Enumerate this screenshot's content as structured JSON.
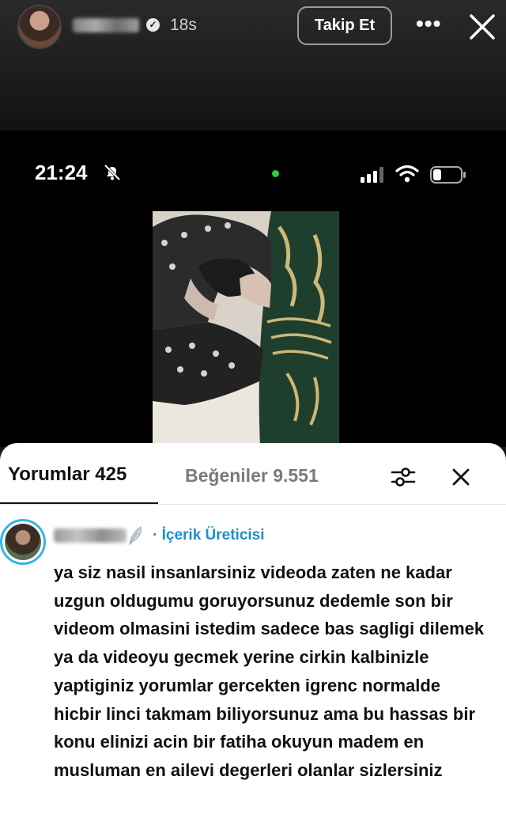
{
  "story": {
    "time_ago": "18s",
    "follow_label": "Takip Et",
    "more_label": "•••"
  },
  "phone_status": {
    "time": "21:24"
  },
  "sheet": {
    "tab_comments": "Yorumlar 425",
    "tab_likes": "Beğeniler 9.551"
  },
  "comment": {
    "role": "· İçerik Üreticisi",
    "text": "ya siz nasil insanlarsiniz videoda zaten ne kadar uzgun oldugumu goruyorsunuz dedemle son bir videom olmasini istedim sadece bas sagligi dilemek ya da videoyu gecmek yerine cirkin kalbinizle yaptiginiz yorumlar gercekten igrenc normalde hicbir linci takmam biliyorsunuz ama bu hassas bir konu elinizi acin bir fatiha okuyun madem en musluman en ailevi degerleri olanlar sizlersiniz"
  },
  "colors": {
    "creator_label": "#1a8fd0",
    "avatar_ring": "#35b6e4",
    "status_dot": "#2ecc40"
  },
  "icons": [
    "verified-icon",
    "more-icon",
    "close-icon",
    "bell-off-icon",
    "signal-icon",
    "wifi-icon",
    "battery-icon",
    "filter-icon",
    "feather-icon"
  ]
}
